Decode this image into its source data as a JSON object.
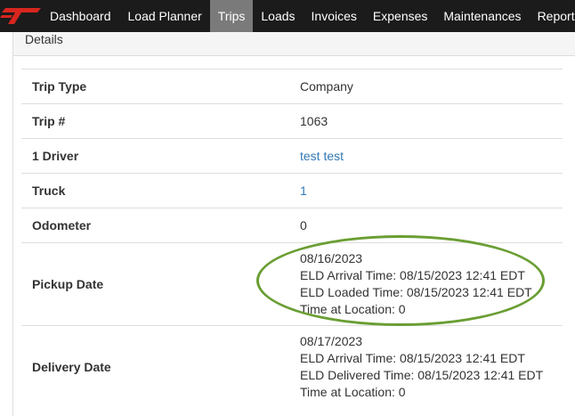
{
  "nav": {
    "items": [
      {
        "label": "Dashboard"
      },
      {
        "label": "Load Planner"
      },
      {
        "label": "Trips",
        "active": true
      },
      {
        "label": "Loads"
      },
      {
        "label": "Invoices"
      },
      {
        "label": "Expenses"
      },
      {
        "label": "Maintenances"
      },
      {
        "label": "Reports"
      }
    ]
  },
  "panel": {
    "heading": "Details"
  },
  "details": {
    "trip_type": {
      "label": "Trip Type",
      "value": "Company"
    },
    "trip_no": {
      "label": "Trip #",
      "value": "1063"
    },
    "driver": {
      "label": "1 Driver",
      "value": "test test"
    },
    "truck": {
      "label": "Truck",
      "value": "1"
    },
    "odometer": {
      "label": "Odometer",
      "value": "0"
    },
    "pickup": {
      "label": "Pickup Date",
      "date": "08/16/2023",
      "arrival": "ELD Arrival Time: 08/15/2023 12:41 EDT",
      "loaded": "ELD Loaded Time: 08/15/2023 12:41 EDT",
      "time_at_location": "Time at Location: 0"
    },
    "delivery": {
      "label": "Delivery Date",
      "date": "08/17/2023",
      "arrival": "ELD Arrival Time: 08/15/2023 12:41 EDT",
      "delivered": "ELD Delivered Time: 08/15/2023 12:41 EDT",
      "time_at_location": "Time at Location: 0"
    }
  },
  "colors": {
    "navbar": "#1b1b1b",
    "nav_active": "#7a7a7a",
    "logo": "#d7261e",
    "link": "#337ab7",
    "highlight": "#6a9e33"
  }
}
